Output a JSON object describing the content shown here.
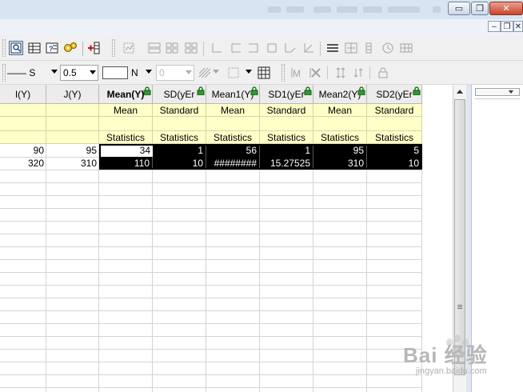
{
  "window": {
    "title_buttons": {
      "minimize": "▭",
      "restore": "❐",
      "close": "✕"
    },
    "mdi_buttons": {
      "minimize": "–",
      "restore": "❐",
      "close": "✕"
    }
  },
  "toolbar2": {
    "line_style": "—— S",
    "line_width": "0.5",
    "fill_none": "N",
    "pattern_value": "0"
  },
  "sheet": {
    "columns": [
      {
        "header": "I(Y)",
        "bold": false,
        "lock": false,
        "long_name": "",
        "comments": ""
      },
      {
        "header": "J(Y)",
        "bold": false,
        "lock": false,
        "long_name": "",
        "comments": ""
      },
      {
        "header": "Mean(Y)",
        "bold": true,
        "lock": true,
        "long_name": "Mean",
        "comments": "Statistics"
      },
      {
        "header": "SD(yEr",
        "bold": false,
        "lock": true,
        "long_name": "Standard",
        "comments": "Statistics"
      },
      {
        "header": "Mean1(Y)",
        "bold": false,
        "lock": true,
        "long_name": "Mean",
        "comments": "Statistics"
      },
      {
        "header": "SD1(yEr",
        "bold": false,
        "lock": true,
        "long_name": "Standard",
        "comments": "Statistics"
      },
      {
        "header": "Mean2(Y)",
        "bold": false,
        "lock": true,
        "long_name": "Mean",
        "comments": "Statistics"
      },
      {
        "header": "SD2(yEr",
        "bold": false,
        "lock": true,
        "long_name": "Standard",
        "comments": "Statistics"
      }
    ],
    "rows": [
      [
        "90",
        "95",
        "34",
        "1",
        "56",
        "1",
        "95",
        "5"
      ],
      [
        "320",
        "310",
        "110",
        "10",
        "########",
        "15.27525",
        "310",
        "10"
      ]
    ],
    "active_cell": "Mean(Y) row 1"
  },
  "watermark": {
    "brand": "Bai 经验",
    "url": "jingyan.baidu.com"
  },
  "colors": {
    "metadata_row": "#ffffc8",
    "selection": "#000000",
    "header": "#ececec"
  }
}
